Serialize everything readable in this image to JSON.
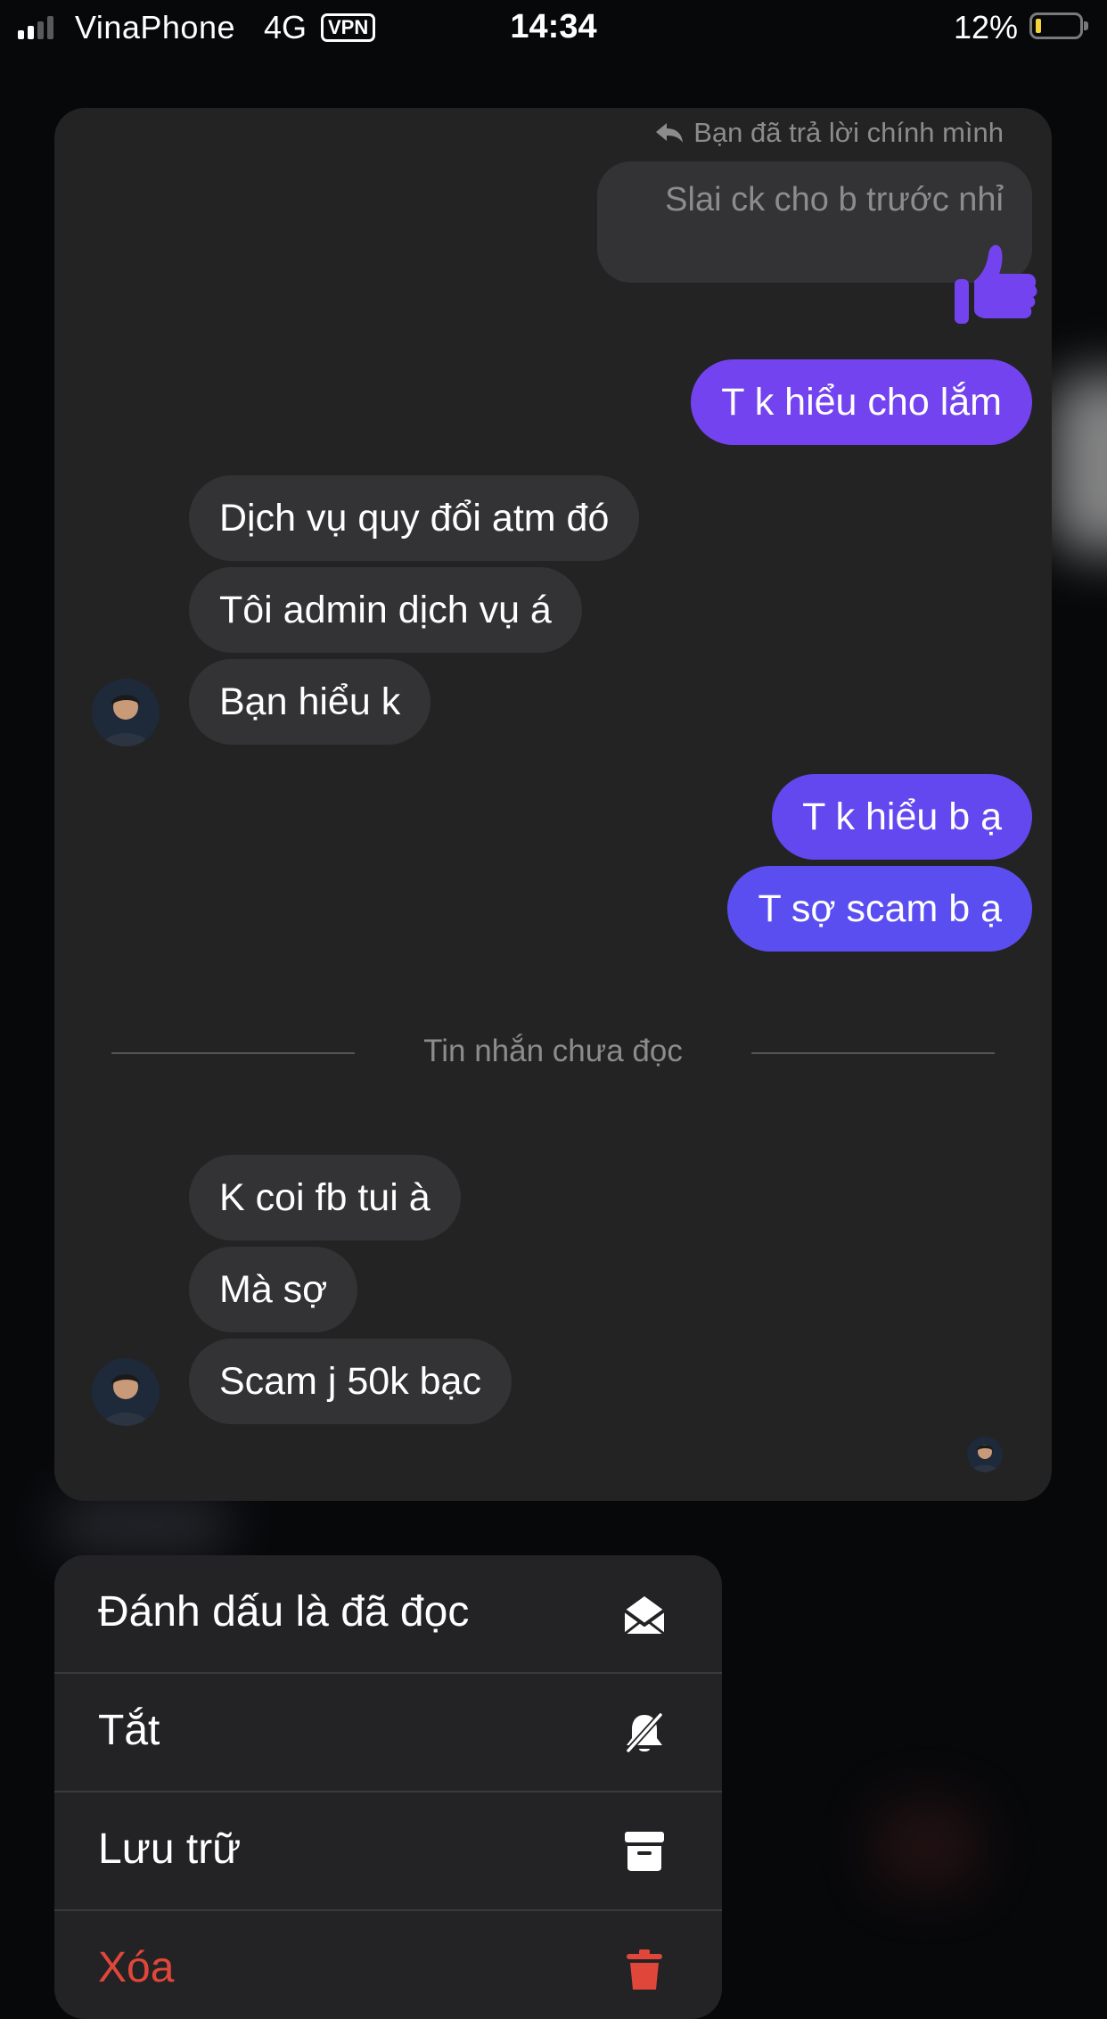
{
  "status_bar": {
    "carrier": "VinaPhone",
    "network": "4G",
    "vpn_label": "VPN",
    "time": "14:34",
    "battery_percent_text": "12%",
    "battery_level": 0.12,
    "battery_color": "#f5d33a"
  },
  "chat_preview": {
    "reply_note": "Bạn đã trả lời chính mình",
    "quoted_message": "Slai ck cho b trước nhỉ",
    "reaction_icon": "thumbs-up-icon",
    "messages": [
      {
        "from": "me",
        "text": "T k hiểu cho lắm"
      },
      {
        "from": "them",
        "text": "Dịch vụ quy đổi atm đó"
      },
      {
        "from": "them",
        "text": "Tôi admin dịch vụ á"
      },
      {
        "from": "them",
        "text": "Bạn hiểu k"
      },
      {
        "from": "me",
        "text": "T k hiểu b ạ"
      },
      {
        "from": "me",
        "text": "T sợ scam b ạ"
      },
      {
        "from": "them",
        "text": "K coi fb tui à"
      },
      {
        "from": "them",
        "text": "Mà sợ"
      },
      {
        "from": "them",
        "text": "Scam j 50k bạc"
      }
    ],
    "unread_divider": "Tin nhắn chưa đọc",
    "accent_color_outgoing_top": "#7443f0",
    "accent_color_outgoing_bottom": "#5a4ef0"
  },
  "context_menu": {
    "items": [
      {
        "label": "Đánh dấu là đã đọc",
        "icon": "envelope-open-icon"
      },
      {
        "label": "Tắt",
        "icon": "bell-slash-icon"
      },
      {
        "label": "Lưu trữ",
        "icon": "archive-box-icon"
      },
      {
        "label": "Xóa",
        "icon": "trash-icon",
        "color": "#e0473a"
      }
    ]
  }
}
